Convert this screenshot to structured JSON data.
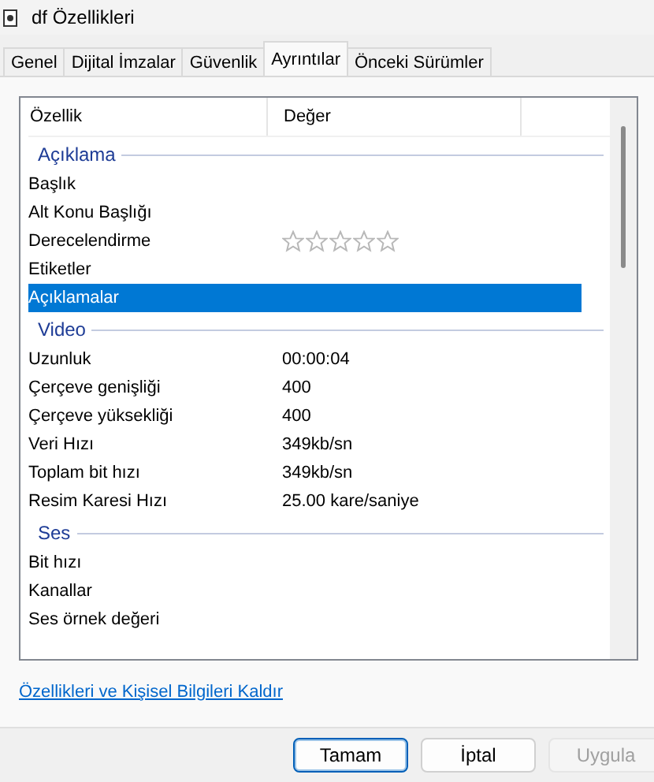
{
  "window": {
    "title": "df Özellikleri"
  },
  "tabs": [
    {
      "label": "Genel",
      "selected": false
    },
    {
      "label": "Dijital İmzalar",
      "selected": false
    },
    {
      "label": "Güvenlik",
      "selected": false
    },
    {
      "label": "Ayrıntılar",
      "selected": true
    },
    {
      "label": "Önceki Sürümler",
      "selected": false
    }
  ],
  "table": {
    "columns": [
      "Özellik",
      "Değer"
    ],
    "rows": [
      {
        "kind": "section",
        "label": "Açıklama"
      },
      {
        "kind": "property",
        "label": "Başlık",
        "selected": false
      },
      {
        "kind": "property",
        "label": "Alt Konu Başlığı",
        "selected": false
      },
      {
        "kind": "rating",
        "label": "Derecelendirme",
        "stars": 0,
        "selected": false
      },
      {
        "kind": "property",
        "label": "Etiketler",
        "selected": false
      },
      {
        "kind": "property",
        "label": "Açıklamalar",
        "selected": true
      },
      {
        "kind": "section",
        "label": "Video"
      },
      {
        "kind": "property",
        "label": "Uzunluk",
        "value": "00:00:04",
        "selected": false
      },
      {
        "kind": "property",
        "label": "Çerçeve genişliği",
        "value": "400",
        "selected": false
      },
      {
        "kind": "property",
        "label": "Çerçeve yüksekliği",
        "value": "400",
        "selected": false
      },
      {
        "kind": "property",
        "label": "Veri Hızı",
        "value": "349kb/sn",
        "selected": false
      },
      {
        "kind": "property",
        "label": "Toplam bit hızı",
        "value": "349kb/sn",
        "selected": false
      },
      {
        "kind": "property",
        "label": "Resim Karesi Hızı",
        "value": "25.00 kare/saniye",
        "selected": false
      },
      {
        "kind": "section",
        "label": "Ses"
      },
      {
        "kind": "property",
        "label": "Bit hızı",
        "selected": false
      },
      {
        "kind": "property",
        "label": "Kanallar",
        "selected": false
      },
      {
        "kind": "property",
        "label": "Ses örnek değeri",
        "selected": false
      }
    ]
  },
  "link": "Özellikleri ve Kişisel Bilgileri Kaldır",
  "buttons": [
    {
      "label": "Tamam",
      "kind": "default",
      "disabled": false
    },
    {
      "label": "İptal",
      "kind": "normal",
      "disabled": false
    },
    {
      "label": "Uygula",
      "kind": "normal",
      "disabled": true
    }
  ]
}
